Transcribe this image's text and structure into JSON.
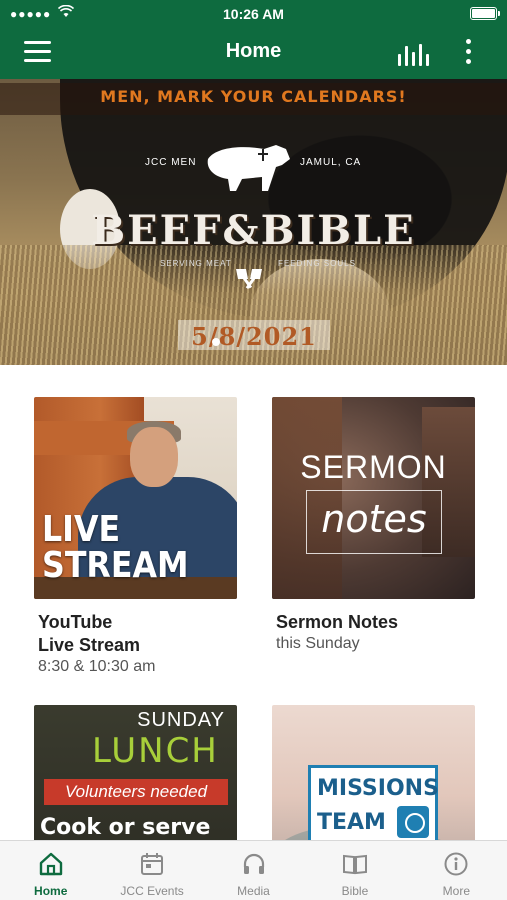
{
  "status_bar": {
    "signal": "●●●●●",
    "wifi": "wifi-icon",
    "time": "10:26 AM",
    "battery": "battery-icon"
  },
  "nav": {
    "title": "Home",
    "menu_icon": "hamburger-menu-icon",
    "chart_icon": "audio-bars-icon",
    "more_icon": "more-vertical-icon"
  },
  "banner": {
    "headline": "MEN, MARK YOUR CALENDARS!",
    "left_tag": "JCC MEN",
    "right_tag": "JAMUL, CA",
    "title": "BEEF&BIBLE",
    "tagline_left": "SERVING MEAT",
    "tagline_right": "FEEDING SOULS",
    "date": "5/8/2021"
  },
  "tiles": [
    {
      "title_line1": "YouTube",
      "title_line2": "Live Stream",
      "subtitle": "8:30 & 10:30 am",
      "image_text_line1": "LIVE",
      "image_text_line2": "STREAM"
    },
    {
      "title_line1": "Sermon Notes",
      "subtitle": "this Sunday",
      "image_text_line1": "SERMON",
      "image_text_line2": "notes"
    },
    {
      "image_text_line1": "SUNDAY",
      "image_text_line2": "LUNCH",
      "image_text_line3": "Volunteers needed",
      "image_text_line4": "Cook or serve"
    },
    {
      "image_text_line1": "MISSIONS",
      "image_text_line2": "TEAM"
    }
  ],
  "tabbar": {
    "active": "Home",
    "items": [
      {
        "label": "Home",
        "icon": "home-icon"
      },
      {
        "label": "JCC Events",
        "icon": "calendar-icon"
      },
      {
        "label": "Media",
        "icon": "headphones-icon"
      },
      {
        "label": "Bible",
        "icon": "book-icon"
      },
      {
        "label": "More",
        "icon": "info-icon"
      }
    ]
  },
  "colors": {
    "brand": "#0e6b3f",
    "tab_inactive": "#8a8a8a"
  }
}
